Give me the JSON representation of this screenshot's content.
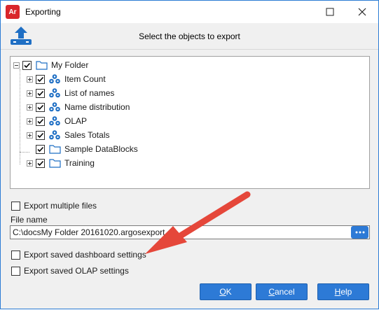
{
  "window": {
    "app_icon_text": "Ar",
    "title": "Exporting"
  },
  "header": {
    "instruction": "Select the objects to export"
  },
  "tree": {
    "root": {
      "label": "My Folder",
      "checked": true,
      "expanded": true
    },
    "children": [
      {
        "label": "Item Count",
        "type": "datablock",
        "checked": true,
        "expandable": true
      },
      {
        "label": "List of names",
        "type": "datablock",
        "checked": true,
        "expandable": true
      },
      {
        "label": "Name distribution",
        "type": "datablock",
        "checked": true,
        "expandable": true
      },
      {
        "label": "OLAP",
        "type": "datablock",
        "checked": true,
        "expandable": true
      },
      {
        "label": "Sales Totals",
        "type": "datablock",
        "checked": true,
        "expandable": true
      },
      {
        "label": "Sample DataBlocks",
        "type": "folder",
        "checked": true,
        "expandable": false
      },
      {
        "label": "Training",
        "type": "folder",
        "checked": true,
        "expandable": true
      }
    ]
  },
  "options": {
    "export_multiple_files": {
      "label": "Export multiple files",
      "checked": false
    },
    "export_dashboard_settings": {
      "label": "Export saved dashboard settings",
      "checked": false
    },
    "export_olap_settings": {
      "label": "Export saved OLAP settings",
      "checked": false
    }
  },
  "file": {
    "label": "File name",
    "value": "C:\\docsMy Folder 20161020.argosexport"
  },
  "buttons": {
    "ok_mnemonic": "O",
    "ok_rest": "K",
    "cancel_mnemonic": "C",
    "cancel_rest": "ancel",
    "help_mnemonic": "H",
    "help_rest": "elp"
  },
  "colors": {
    "accent": "#2d7ad6",
    "annotation_arrow": "#e5473a",
    "datablock_icon": "#1f6fc4"
  }
}
